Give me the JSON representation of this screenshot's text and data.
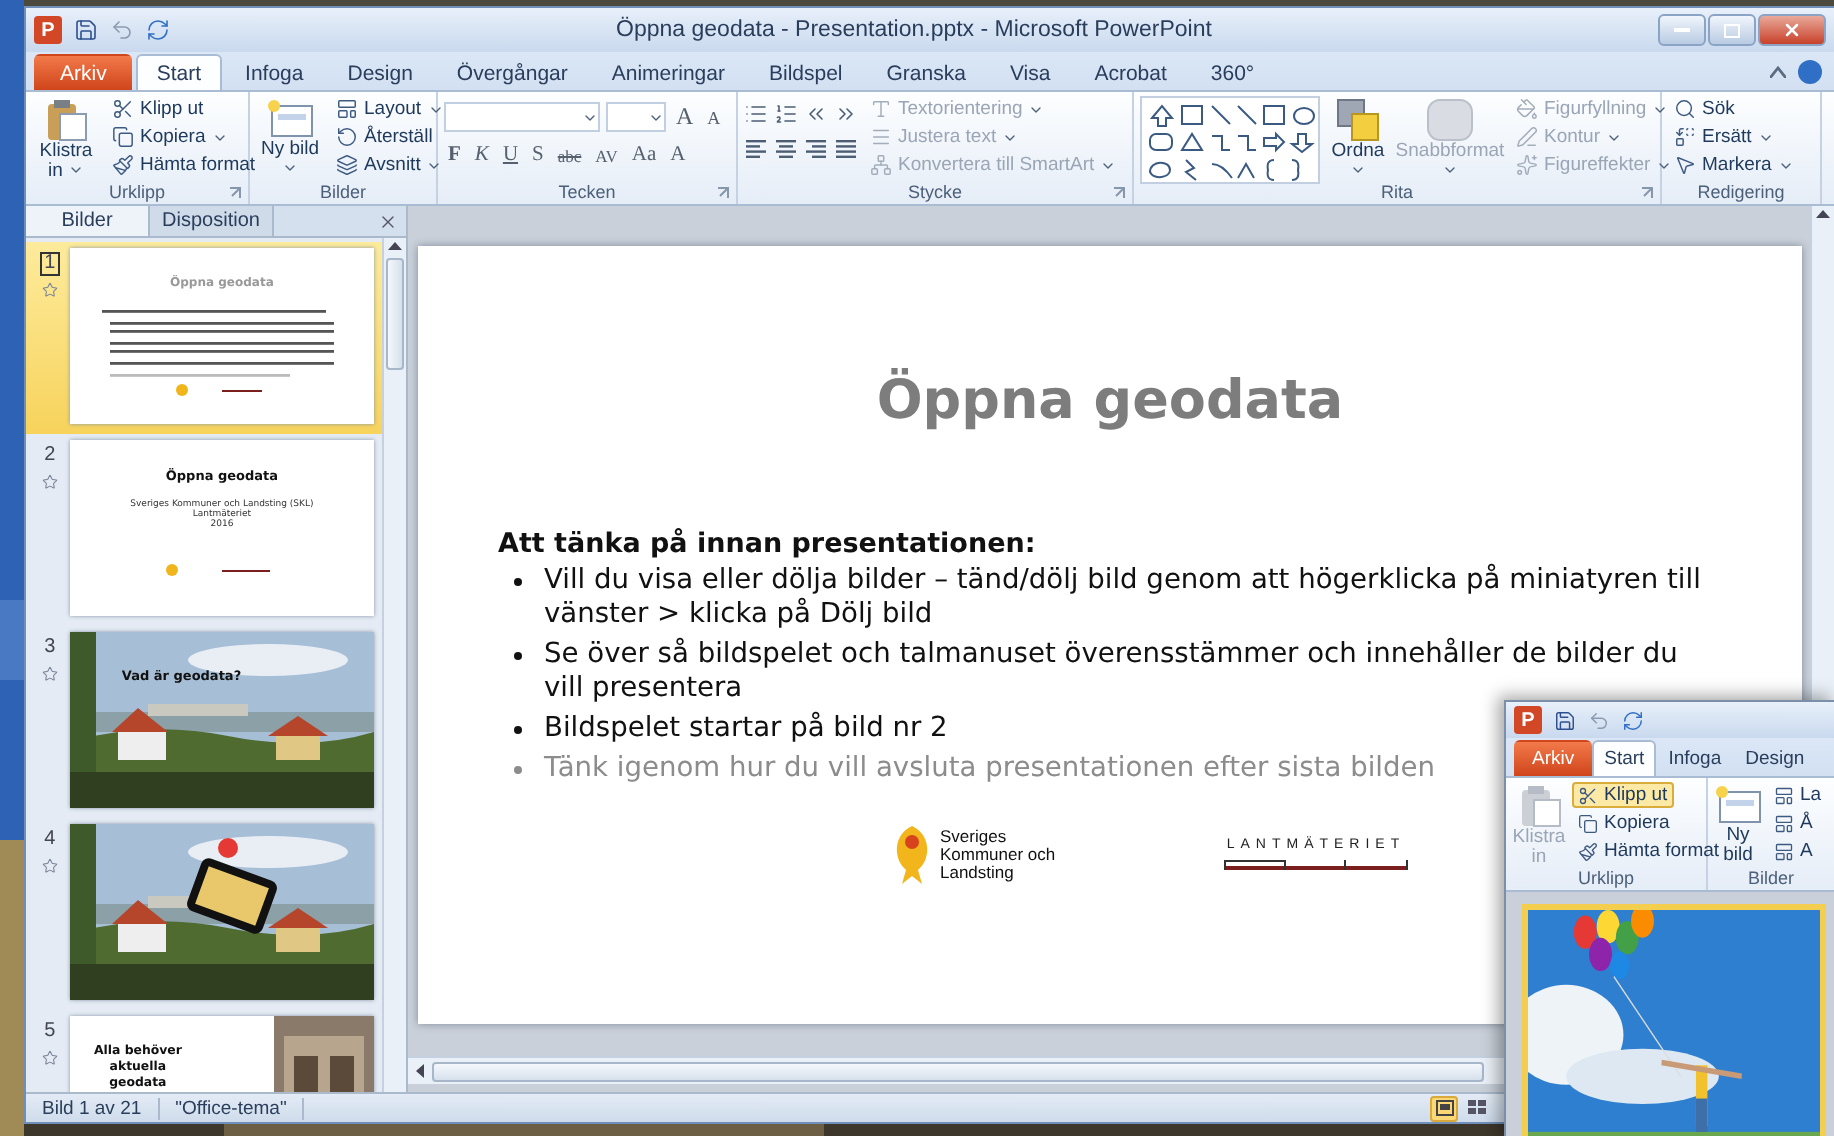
{
  "window": {
    "app_letter": "P",
    "title": "Öppna geodata - Presentation.pptx - Microsoft PowerPoint"
  },
  "ribbon_tabs": [
    {
      "label": "Arkiv",
      "kind": "file",
      "selected": false
    },
    {
      "label": "Start",
      "kind": "tab",
      "selected": true
    },
    {
      "label": "Infoga",
      "kind": "tab",
      "selected": false
    },
    {
      "label": "Design",
      "kind": "tab",
      "selected": false
    },
    {
      "label": "Övergångar",
      "kind": "tab",
      "selected": false
    },
    {
      "label": "Animeringar",
      "kind": "tab",
      "selected": false
    },
    {
      "label": "Bildspel",
      "kind": "tab",
      "selected": false
    },
    {
      "label": "Granska",
      "kind": "tab",
      "selected": false
    },
    {
      "label": "Visa",
      "kind": "tab",
      "selected": false
    },
    {
      "label": "Acrobat",
      "kind": "tab",
      "selected": false
    },
    {
      "label": "360°",
      "kind": "tab",
      "selected": false
    }
  ],
  "ribbon_groups": [
    {
      "label": "Urklipp",
      "kind": "clipboard",
      "large": [
        {
          "label": "Klistra in",
          "dropdown": true,
          "disabled": false
        }
      ],
      "small": [
        {
          "label": "Klipp ut",
          "dropdown": false,
          "disabled": false
        },
        {
          "label": "Kopiera",
          "dropdown": true,
          "disabled": false
        },
        {
          "label": "Hämta format",
          "dropdown": false,
          "disabled": false
        }
      ]
    },
    {
      "label": "Bilder",
      "kind": "slides",
      "large": [
        {
          "label": "Ny bild",
          "dropdown": true,
          "disabled": false
        }
      ],
      "small": [
        {
          "label": "Layout",
          "dropdown": true,
          "disabled": false
        },
        {
          "label": "Återställ",
          "dropdown": false,
          "disabled": false
        },
        {
          "label": "Avsnitt",
          "dropdown": true,
          "disabled": false
        }
      ]
    },
    {
      "label": "Tecken",
      "kind": "font",
      "size_buttons": [
        "A",
        "A"
      ],
      "format_buttons": [
        "F",
        "K",
        "U",
        "S",
        "abc",
        "AV",
        "Aa",
        "A"
      ]
    },
    {
      "label": "Stycke",
      "kind": "paragraph",
      "small": [
        {
          "label": "Textorientering",
          "dropdown": true,
          "disabled": true
        },
        {
          "label": "Justera text",
          "dropdown": true,
          "disabled": true
        },
        {
          "label": "Konvertera till SmartArt",
          "dropdown": true,
          "disabled": true
        }
      ]
    },
    {
      "label": "Rita",
      "kind": "drawing",
      "large": [
        {
          "label": "Ordna",
          "dropdown": true,
          "disabled": false
        },
        {
          "label": "Snabbformat",
          "dropdown": true,
          "disabled": true
        }
      ],
      "small": [
        {
          "label": "Figurfyllning",
          "dropdown": true,
          "disabled": true
        },
        {
          "label": "Kontur",
          "dropdown": true,
          "disabled": true
        },
        {
          "label": "Figureffekter",
          "dropdown": true,
          "disabled": true
        }
      ]
    },
    {
      "label": "Redigering",
      "kind": "editing",
      "small": [
        {
          "label": "Sök",
          "dropdown": false,
          "disabled": false
        },
        {
          "label": "Ersätt",
          "dropdown": true,
          "disabled": false
        },
        {
          "label": "Markera",
          "dropdown": true,
          "disabled": false
        }
      ]
    }
  ],
  "pane_tabs": [
    {
      "label": "Bilder",
      "selected": true
    },
    {
      "label": "Disposition",
      "selected": false
    }
  ],
  "thumbnails": [
    {
      "number": "1",
      "kind": "bullets",
      "selected": true,
      "title": "Öppna geodata"
    },
    {
      "number": "2",
      "kind": "title",
      "selected": false,
      "title": "Öppna geodata",
      "lines": [
        "Sveriges Kommuner och Landsting (SKL)",
        "Lantmäteriet",
        "2016"
      ]
    },
    {
      "number": "3",
      "selected": false,
      "title": "Vad är geodata?"
    },
    {
      "number": "4",
      "kind": "photo_phone",
      "selected": false
    },
    {
      "number": "5",
      "kind": "split",
      "selected": false,
      "title": "Alla behöver aktuella geodata"
    }
  ],
  "slide": {
    "title": "Öppna geodata",
    "heading": "Att tänka på innan presentationen:",
    "bullets": [
      {
        "text": "Vill du visa eller dölja bilder – tänd/dölj bild genom att högerklicka på miniatyren till vänster > klicka på Dölj bild",
        "dimmed": false
      },
      {
        "text": "Se över så bildspelet och talmanuset överensstämmer och innehåller de bilder du vill presentera",
        "dimmed": false
      },
      {
        "text": "Bildspelet startar på bild nr 2",
        "dimmed": false
      },
      {
        "text": "Tänk igenom hur du vill avsluta presentationen efter sista bilden",
        "dimmed": true
      }
    ],
    "logo_text": "Sveriges Kommuner och Landsting",
    "second_logo_text": "LANTMÄTERIET"
  },
  "status_bar": {
    "slide": "Bild 1 av 21",
    "theme": "\"Office-tema\""
  },
  "second_window": {
    "app_letter": "P",
    "tabs": [
      {
        "label": "Arkiv",
        "kind": "file",
        "selected": false
      },
      {
        "label": "Start",
        "kind": "tab",
        "selected": true
      },
      {
        "label": "Infoga",
        "kind": "tab",
        "selected": false
      },
      {
        "label": "Design",
        "kind": "tab",
        "selected": false
      }
    ],
    "buttons": [
      {
        "label": "Klistra in",
        "kind": "large",
        "disabled": true,
        "highlighted": false
      },
      {
        "label": "Klipp ut",
        "kind": "small",
        "disabled": false,
        "highlighted": true
      },
      {
        "label": "Kopiera",
        "kind": "small",
        "disabled": false,
        "highlighted": false
      },
      {
        "label": "Hämta format",
        "kind": "small",
        "disabled": false,
        "highlighted": false
      }
    ],
    "second_buttons": [
      {
        "label": "Ny bild",
        "kind": "large"
      },
      {
        "label": "La",
        "kind": "small"
      },
      {
        "label": "Å",
        "kind": "small"
      },
      {
        "label": "A",
        "kind": "small"
      }
    ],
    "group_labels": [
      "Urklipp",
      "Bilder"
    ]
  }
}
